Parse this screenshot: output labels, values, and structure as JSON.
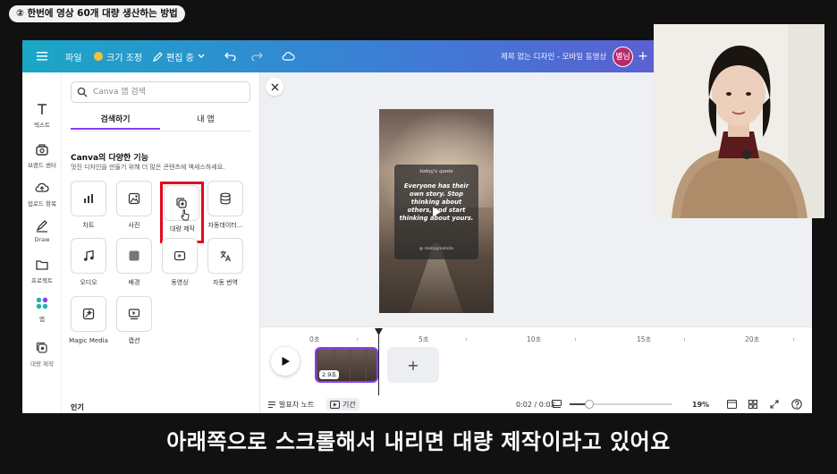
{
  "overlay": {
    "step_chip": "② 한번에 영상 60개 대량 생산하는 방법",
    "subtitle": "아래쪽으로 스크롤해서 내리면 대량 제작이라고 있어요"
  },
  "topbar": {
    "file": "파일",
    "resize": "크기 조정",
    "edit_mode": "편집 중",
    "doc_title": "제목 없는 디자인 - 모바일 동영상",
    "avatar": "별님",
    "plus": "+"
  },
  "rail": [
    {
      "label": "텍스트",
      "icon": "text-icon"
    },
    {
      "label": "브랜드 센터",
      "icon": "brand-icon"
    },
    {
      "label": "업로드 항목",
      "icon": "upload-icon"
    },
    {
      "label": "Draw",
      "icon": "draw-icon"
    },
    {
      "label": "프로젝트",
      "icon": "folder-icon"
    },
    {
      "label": "앱",
      "icon": "apps-icon"
    },
    {
      "label": "대량 제작",
      "icon": "bulk-create-icon"
    }
  ],
  "panel": {
    "search_placeholder": "Canva 앱 검색",
    "tab_discover": "검색하기",
    "tab_myapps": "내 앱",
    "section_title": "Canva의 다양한 기능",
    "section_sub": "멋진 디자인을 만들기 위해 더 많은 콘텐츠에 액세스하세요.",
    "tiles": [
      {
        "label": "차트",
        "icon": "chart-icon"
      },
      {
        "label": "사진",
        "icon": "photo-icon"
      },
      {
        "label": "대량 제작",
        "icon": "bulk-create-icon"
      },
      {
        "label": "자동데이터...",
        "icon": "database-icon"
      },
      {
        "label": "오디오",
        "icon": "audio-icon"
      },
      {
        "label": "배경",
        "icon": "background-icon"
      },
      {
        "label": "동영상",
        "icon": "video-icon"
      },
      {
        "label": "자동 번역",
        "icon": "translate-icon"
      },
      {
        "label": "Magic Media",
        "icon": "magic-media-icon"
      },
      {
        "label": "캡션",
        "icon": "caption-icon"
      }
    ],
    "popular_title": "인기"
  },
  "poster": {
    "title": "today's quote",
    "text": "Everyone has their own story. Stop thinking about others, and start thinking about yours.",
    "handle": "@ reallygreatsite"
  },
  "timeline": {
    "ruler": [
      "0초",
      "5초",
      "10초",
      "15초",
      "20초"
    ],
    "clip_duration": "2.9초",
    "add": "+"
  },
  "bottombar": {
    "notes": "발표자 노트",
    "duration": "기간",
    "time": "0:02 / 0:02",
    "zoom_pct": "19%",
    "zoom_level": 0.19
  }
}
